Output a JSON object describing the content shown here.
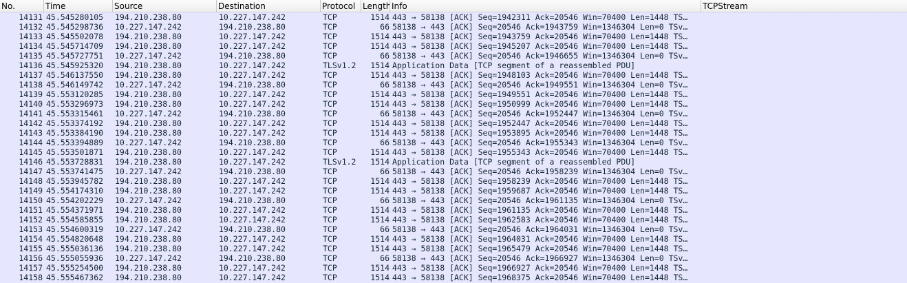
{
  "columns": {
    "no": "No.",
    "time": "Time",
    "source": "Source",
    "destination": "Destination",
    "protocol": "Protocol",
    "length": "Length",
    "info": "Info",
    "tcpstream": "TCPStream"
  },
  "colors": {
    "row_background": "#e7e6ff",
    "row_text": "#12272e"
  },
  "packets": [
    {
      "no": "14131",
      "time": "45.545280105",
      "src": "194.210.238.80",
      "dst": "10.227.147.242",
      "proto": "TCP",
      "len": "1514",
      "info": "443 → 58138 [ACK] Seq=1942311 Ack=20546 Win=70400 Len=1448 TS…",
      "stream": ""
    },
    {
      "no": "14132",
      "time": "45.545298736",
      "src": "10.227.147.242",
      "dst": "194.210.238.80",
      "proto": "TCP",
      "len": "66",
      "info": "58138 → 443 [ACK] Seq=20546 Ack=1943759 Win=1346304 Len=0 TSv…",
      "stream": ""
    },
    {
      "no": "14133",
      "time": "45.545502078",
      "src": "194.210.238.80",
      "dst": "10.227.147.242",
      "proto": "TCP",
      "len": "1514",
      "info": "443 → 58138 [ACK] Seq=1943759 Ack=20546 Win=70400 Len=1448 TS…",
      "stream": ""
    },
    {
      "no": "14134",
      "time": "45.545714709",
      "src": "194.210.238.80",
      "dst": "10.227.147.242",
      "proto": "TCP",
      "len": "1514",
      "info": "443 → 58138 [ACK] Seq=1945207 Ack=20546 Win=70400 Len=1448 TS…",
      "stream": ""
    },
    {
      "no": "14135",
      "time": "45.545727751",
      "src": "10.227.147.242",
      "dst": "194.210.238.80",
      "proto": "TCP",
      "len": "66",
      "info": "58138 → 443 [ACK] Seq=20546 Ack=1946655 Win=1346304 Len=0 TSv…",
      "stream": ""
    },
    {
      "no": "14136",
      "time": "45.545925320",
      "src": "194.210.238.80",
      "dst": "10.227.147.242",
      "proto": "TLSv1.2",
      "len": "1514",
      "info": "Application Data [TCP segment of a reassembled PDU]",
      "stream": ""
    },
    {
      "no": "14137",
      "time": "45.546137550",
      "src": "194.210.238.80",
      "dst": "10.227.147.242",
      "proto": "TCP",
      "len": "1514",
      "info": "443 → 58138 [ACK] Seq=1948103 Ack=20546 Win=70400 Len=1448 TS…",
      "stream": ""
    },
    {
      "no": "14138",
      "time": "45.546149742",
      "src": "10.227.147.242",
      "dst": "194.210.238.80",
      "proto": "TCP",
      "len": "66",
      "info": "58138 → 443 [ACK] Seq=20546 Ack=1949551 Win=1346304 Len=0 TSv…",
      "stream": ""
    },
    {
      "no": "14139",
      "time": "45.553120285",
      "src": "194.210.238.80",
      "dst": "10.227.147.242",
      "proto": "TCP",
      "len": "1514",
      "info": "443 → 58138 [ACK] Seq=1949551 Ack=20546 Win=70400 Len=1448 TS…",
      "stream": ""
    },
    {
      "no": "14140",
      "time": "45.553296973",
      "src": "194.210.238.80",
      "dst": "10.227.147.242",
      "proto": "TCP",
      "len": "1514",
      "info": "443 → 58138 [ACK] Seq=1950999 Ack=20546 Win=70400 Len=1448 TS…",
      "stream": ""
    },
    {
      "no": "14141",
      "time": "45.553315461",
      "src": "10.227.147.242",
      "dst": "194.210.238.80",
      "proto": "TCP",
      "len": "66",
      "info": "58138 → 443 [ACK] Seq=20546 Ack=1952447 Win=1346304 Len=0 TSv…",
      "stream": ""
    },
    {
      "no": "14142",
      "time": "45.553374192",
      "src": "194.210.238.80",
      "dst": "10.227.147.242",
      "proto": "TCP",
      "len": "1514",
      "info": "443 → 58138 [ACK] Seq=1952447 Ack=20546 Win=70400 Len=1448 TS…",
      "stream": ""
    },
    {
      "no": "14143",
      "time": "45.553384190",
      "src": "194.210.238.80",
      "dst": "10.227.147.242",
      "proto": "TCP",
      "len": "1514",
      "info": "443 → 58138 [ACK] Seq=1953895 Ack=20546 Win=70400 Len=1448 TS…",
      "stream": ""
    },
    {
      "no": "14144",
      "time": "45.553394889",
      "src": "10.227.147.242",
      "dst": "194.210.238.80",
      "proto": "TCP",
      "len": "66",
      "info": "58138 → 443 [ACK] Seq=20546 Ack=1955343 Win=1346304 Len=0 TSv…",
      "stream": ""
    },
    {
      "no": "14145",
      "time": "45.553501871",
      "src": "194.210.238.80",
      "dst": "10.227.147.242",
      "proto": "TCP",
      "len": "1514",
      "info": "443 → 58138 [ACK] Seq=1955343 Ack=20546 Win=70400 Len=1448 TS…",
      "stream": ""
    },
    {
      "no": "14146",
      "time": "45.553728831",
      "src": "194.210.238.80",
      "dst": "10.227.147.242",
      "proto": "TLSv1.2",
      "len": "1514",
      "info": "Application Data [TCP segment of a reassembled PDU]",
      "stream": ""
    },
    {
      "no": "14147",
      "time": "45.553741475",
      "src": "10.227.147.242",
      "dst": "194.210.238.80",
      "proto": "TCP",
      "len": "66",
      "info": "58138 → 443 [ACK] Seq=20546 Ack=1958239 Win=1346304 Len=0 TSv…",
      "stream": ""
    },
    {
      "no": "14148",
      "time": "45.553945782",
      "src": "194.210.238.80",
      "dst": "10.227.147.242",
      "proto": "TCP",
      "len": "1514",
      "info": "443 → 58138 [ACK] Seq=1958239 Ack=20546 Win=70400 Len=1448 TS…",
      "stream": ""
    },
    {
      "no": "14149",
      "time": "45.554174310",
      "src": "194.210.238.80",
      "dst": "10.227.147.242",
      "proto": "TCP",
      "len": "1514",
      "info": "443 → 58138 [ACK] Seq=1959687 Ack=20546 Win=70400 Len=1448 TS…",
      "stream": ""
    },
    {
      "no": "14150",
      "time": "45.554202229",
      "src": "10.227.147.242",
      "dst": "194.210.238.80",
      "proto": "TCP",
      "len": "66",
      "info": "58138 → 443 [ACK] Seq=20546 Ack=1961135 Win=1346304 Len=0 TSv…",
      "stream": ""
    },
    {
      "no": "14151",
      "time": "45.554371971",
      "src": "194.210.238.80",
      "dst": "10.227.147.242",
      "proto": "TCP",
      "len": "1514",
      "info": "443 → 58138 [ACK] Seq=1961135 Ack=20546 Win=70400 Len=1448 TS…",
      "stream": ""
    },
    {
      "no": "14152",
      "time": "45.554585855",
      "src": "194.210.238.80",
      "dst": "10.227.147.242",
      "proto": "TCP",
      "len": "1514",
      "info": "443 → 58138 [ACK] Seq=1962583 Ack=20546 Win=70400 Len=1448 TS…",
      "stream": ""
    },
    {
      "no": "14153",
      "time": "45.554600319",
      "src": "10.227.147.242",
      "dst": "194.210.238.80",
      "proto": "TCP",
      "len": "66",
      "info": "58138 → 443 [ACK] Seq=20546 Ack=1964031 Win=1346304 Len=0 TSv…",
      "stream": ""
    },
    {
      "no": "14154",
      "time": "45.554820648",
      "src": "194.210.238.80",
      "dst": "10.227.147.242",
      "proto": "TCP",
      "len": "1514",
      "info": "443 → 58138 [ACK] Seq=1964031 Ack=20546 Win=70400 Len=1448 TS…",
      "stream": ""
    },
    {
      "no": "14155",
      "time": "45.555036136",
      "src": "194.210.238.80",
      "dst": "10.227.147.242",
      "proto": "TCP",
      "len": "1514",
      "info": "443 → 58138 [ACK] Seq=1965479 Ack=20546 Win=70400 Len=1448 TS…",
      "stream": ""
    },
    {
      "no": "14156",
      "time": "45.555055936",
      "src": "10.227.147.242",
      "dst": "194.210.238.80",
      "proto": "TCP",
      "len": "66",
      "info": "58138 → 443 [ACK] Seq=20546 Ack=1966927 Win=1346304 Len=0 TSv…",
      "stream": ""
    },
    {
      "no": "14157",
      "time": "45.555254500",
      "src": "194.210.238.80",
      "dst": "10.227.147.242",
      "proto": "TCP",
      "len": "1514",
      "info": "443 → 58138 [ACK] Seq=1966927 Ack=20546 Win=70400 Len=1448 TS…",
      "stream": ""
    },
    {
      "no": "14158",
      "time": "45.555467362",
      "src": "194.210.238.80",
      "dst": "10.227.147.242",
      "proto": "TCP",
      "len": "1514",
      "info": "443 → 58138 [ACK] Seq=1968375 Ack=20546 Win=70400 Len=1448 TS…",
      "stream": ""
    }
  ]
}
